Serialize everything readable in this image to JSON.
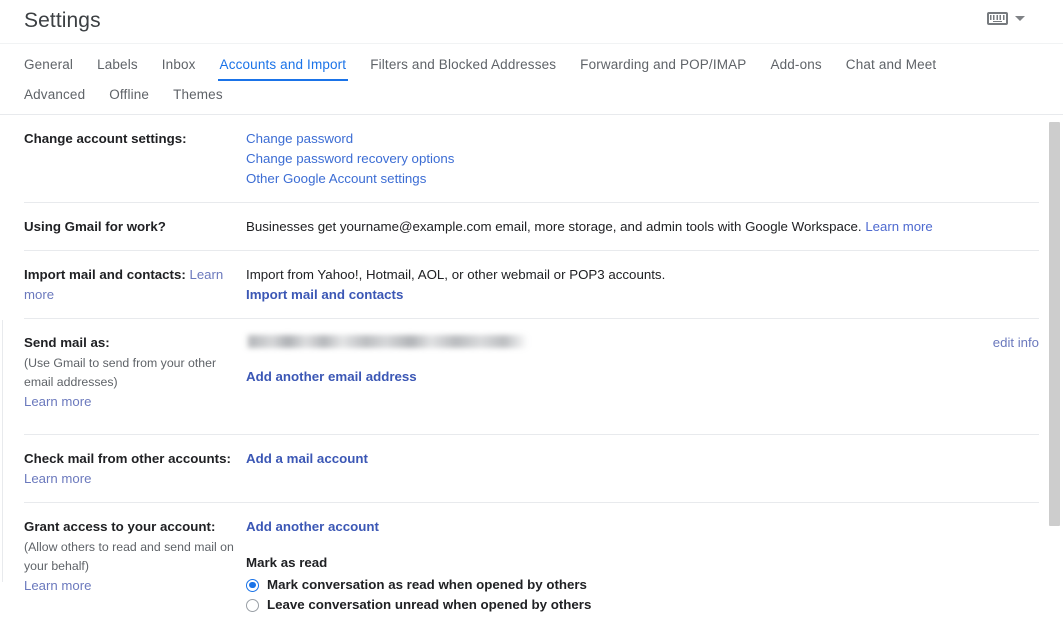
{
  "header": {
    "title": "Settings",
    "keyboard_icon": "keyboard-icon",
    "caret_icon": "chevron-down-icon"
  },
  "tabs": {
    "row1": [
      {
        "label": "General",
        "active": false
      },
      {
        "label": "Labels",
        "active": false
      },
      {
        "label": "Inbox",
        "active": false
      },
      {
        "label": "Accounts and Import",
        "active": true
      },
      {
        "label": "Filters and Blocked Addresses",
        "active": false
      },
      {
        "label": "Forwarding and POP/IMAP",
        "active": false
      },
      {
        "label": "Add-ons",
        "active": false
      },
      {
        "label": "Chat and Meet",
        "active": false
      }
    ],
    "row2": [
      {
        "label": "Advanced",
        "active": false
      },
      {
        "label": "Offline",
        "active": false
      },
      {
        "label": "Themes",
        "active": false
      }
    ]
  },
  "sections": {
    "change_account": {
      "label": "Change account settings:",
      "links": [
        "Change password",
        "Change password recovery options",
        "Other Google Account settings"
      ]
    },
    "gmail_for_work": {
      "label": "Using Gmail for work?",
      "text": "Businesses get yourname@example.com email, more storage, and admin tools with Google Workspace.",
      "learn_more": "Learn more"
    },
    "import": {
      "label": "Import mail and contacts:",
      "learn_more": "Learn more",
      "description": "Import from Yahoo!, Hotmail, AOL, or other webmail or POP3 accounts.",
      "action": "Import mail and contacts"
    },
    "send_mail_as": {
      "label": "Send mail as:",
      "sub": "(Use Gmail to send from your other email addresses)",
      "learn_more": "Learn more",
      "address_redacted": true,
      "edit_info": "edit info",
      "action": "Add another email address"
    },
    "check_mail": {
      "label": "Check mail from other accounts:",
      "learn_more": "Learn more",
      "action": "Add a mail account"
    },
    "grant_access": {
      "label": "Grant access to your account:",
      "sub": "(Allow others to read and send mail on your behalf)",
      "learn_more": "Learn more",
      "action": "Add another account",
      "mark_as_read_heading": "Mark as read",
      "options": [
        {
          "label": "Mark conversation as read when opened by others",
          "selected": true
        },
        {
          "label": "Leave conversation unread when opened by others",
          "selected": false
        }
      ]
    }
  },
  "colors": {
    "accent": "#1a73e8",
    "link": "#3c6dd4",
    "muted_link": "#6b79bd",
    "text": "#202124",
    "muted_text": "#5f6368",
    "divider": "#e8eaed"
  }
}
